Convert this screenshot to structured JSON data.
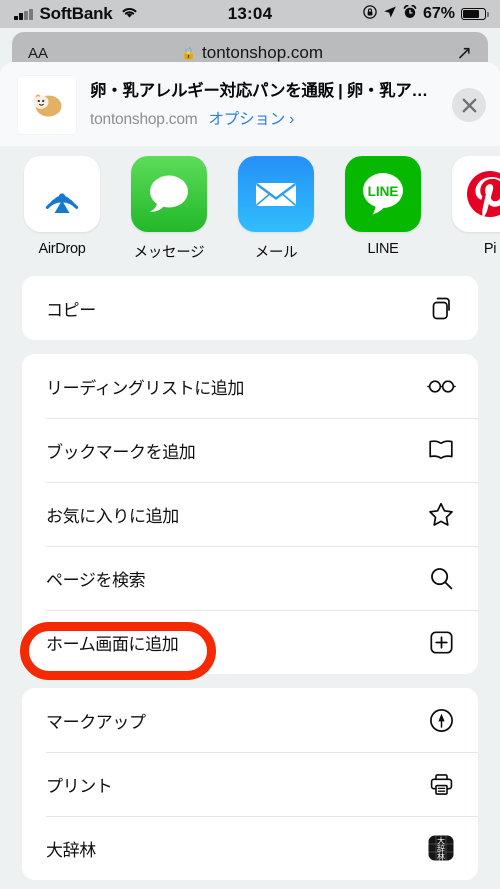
{
  "status_bar": {
    "carrier": "SoftBank",
    "wifi_icon": "wifi-icon",
    "signal_icon": "cellular-signal-icon",
    "time": "13:04",
    "rotation_lock_icon": "rotation-lock-icon",
    "location_icon": "location-arrow-icon",
    "alarm_icon": "alarm-clock-icon",
    "battery_percent": "67%",
    "battery_icon": "battery-icon"
  },
  "safari": {
    "aa_label": "AA",
    "lock_icon": "lock-icon",
    "url": "tontonshop.com",
    "share_icon": "share-arrow-icon"
  },
  "share_sheet": {
    "header": {
      "favicon_icon": "site-favicon",
      "title": "卵・乳アレルギー対応パンを通販 | 卵・乳アレ…",
      "domain": "tontonshop.com",
      "options_label": "オプション ›",
      "close_icon": "close-icon"
    },
    "apps": [
      {
        "label": "AirDrop",
        "icon": "airdrop-icon",
        "bg": "#ffffff"
      },
      {
        "label": "メッセージ",
        "icon": "messages-icon",
        "bg": "#3bc44a"
      },
      {
        "label": "メール",
        "icon": "mail-icon",
        "bg": "#1d9ef5"
      },
      {
        "label": "LINE",
        "icon": "line-icon",
        "bg": "#06b800"
      },
      {
        "label": "Pi",
        "icon": "pinterest-icon",
        "bg": "#ffffff"
      }
    ],
    "groups": [
      {
        "rows": [
          {
            "label": "コピー",
            "icon": "copy-icon"
          }
        ]
      },
      {
        "rows": [
          {
            "label": "リーディングリストに追加",
            "icon": "glasses-icon"
          },
          {
            "label": "ブックマークを追加",
            "icon": "book-icon"
          },
          {
            "label": "お気に入りに追加",
            "icon": "star-icon"
          },
          {
            "label": "ページを検索",
            "icon": "search-icon"
          },
          {
            "label": "ホーム画面に追加",
            "icon": "add-to-home-icon"
          }
        ]
      },
      {
        "rows": [
          {
            "label": "マークアップ",
            "icon": "markup-icon"
          },
          {
            "label": "プリント",
            "icon": "printer-icon"
          },
          {
            "label": "大辞林",
            "icon": "daijirin-app-icon"
          }
        ]
      }
    ]
  },
  "annotation": {
    "target_label": "ホーム画面に追加",
    "shape": "oval",
    "color": "#f42a05"
  }
}
